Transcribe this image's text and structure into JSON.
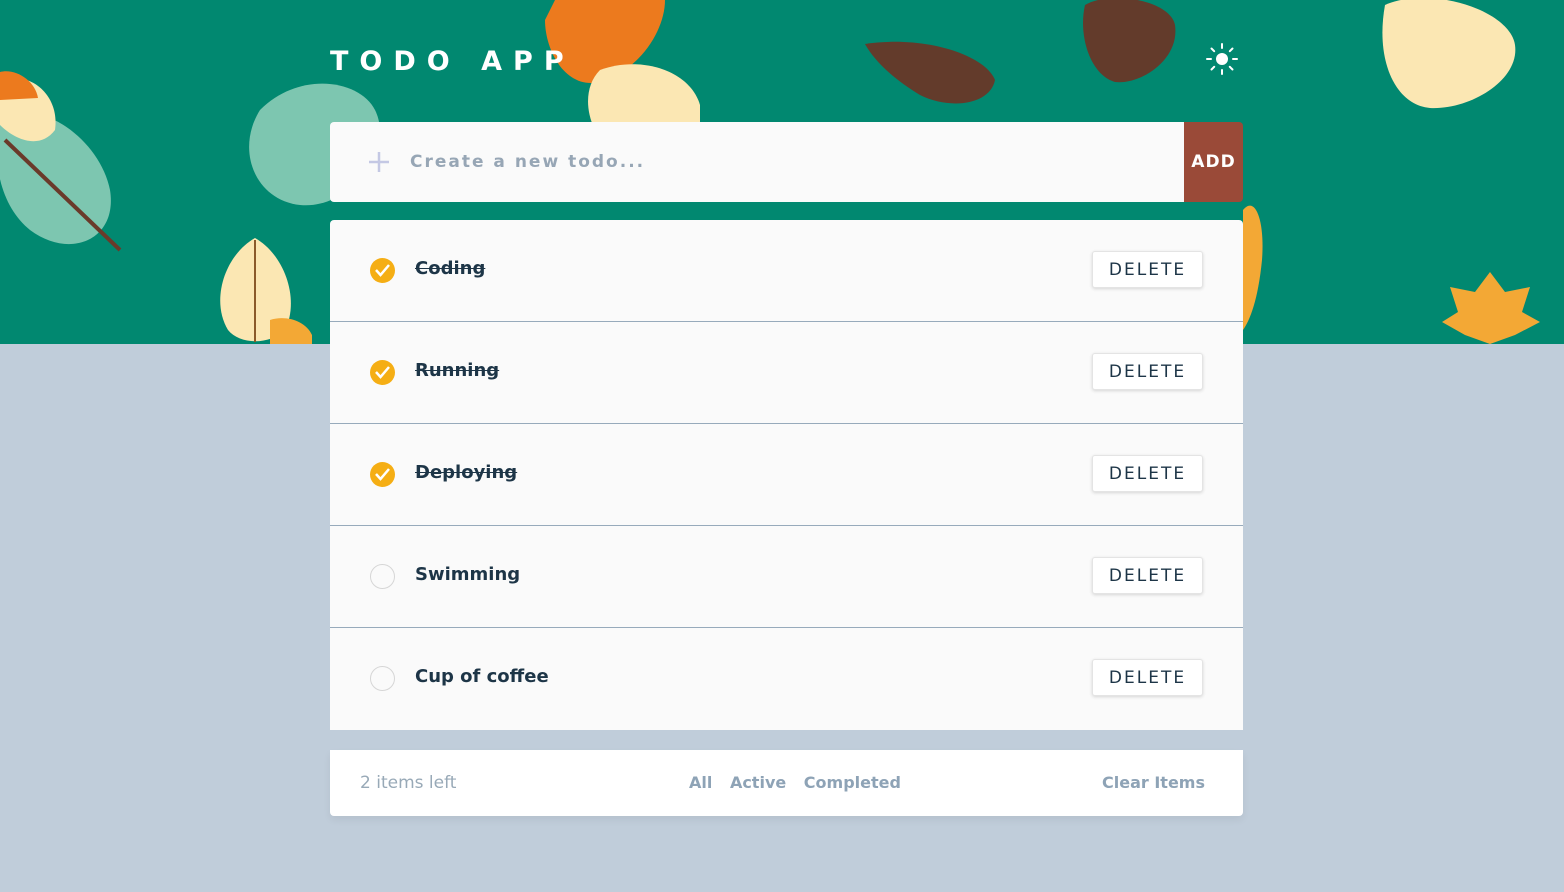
{
  "app": {
    "title": "TODO APP",
    "theme_icon": "sun-icon"
  },
  "new_todo": {
    "placeholder": "Create a new todo...",
    "value": "",
    "add_label": "ADD",
    "plus_icon": "plus-icon"
  },
  "todos": [
    {
      "text": "Coding",
      "completed": true,
      "delete_label": "DELETE"
    },
    {
      "text": "Running",
      "completed": true,
      "delete_label": "DELETE"
    },
    {
      "text": "Deploying",
      "completed": true,
      "delete_label": "DELETE"
    },
    {
      "text": "Swimming",
      "completed": false,
      "delete_label": "DELETE"
    },
    {
      "text": "Cup of coffee",
      "completed": false,
      "delete_label": "DELETE"
    }
  ],
  "footer": {
    "items_left": "2 items left",
    "filters": [
      "All",
      "Active",
      "Completed"
    ],
    "clear_label": "Clear Items"
  },
  "colors": {
    "header_bg": "#018870",
    "page_bg": "#c0cdda",
    "check": "#f5ae14",
    "add_button": "#9a4a38",
    "text": "#1d3547",
    "muted": "#97a6b5"
  }
}
